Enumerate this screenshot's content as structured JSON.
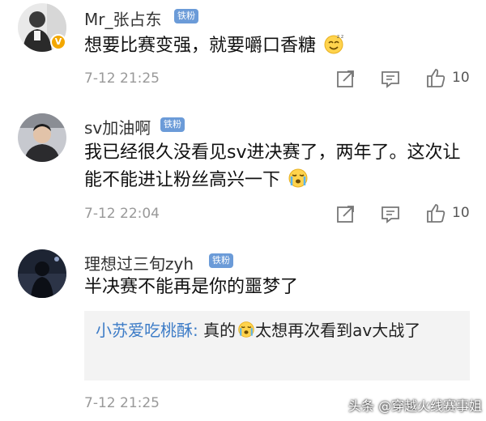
{
  "comments": [
    {
      "username": "Mr_张占东",
      "fan_badge": "铁粉",
      "text": "想要比赛变强，就要嚼口香糖",
      "emoji": "smile-emoji",
      "date": "7-12",
      "time": "21:25",
      "likes": "10",
      "verified": true
    },
    {
      "username": "sv加油啊",
      "fan_badge": "铁粉",
      "text": "我已经很久没看见sv进决赛了，两年了。这次让能不能进让粉丝高兴一下",
      "emoji": "crying-emoji",
      "date": "7-12",
      "time": "22:04",
      "likes": "10",
      "verified": false
    },
    {
      "username": "理想过三旬zyh",
      "fan_badge": "铁粉",
      "text": "半决赛不能再是你的噩梦了",
      "date": "7-12",
      "time": "21:25",
      "verified": false,
      "reply": {
        "user": "小苏爱吃桃酥:",
        "text_a": " 真的",
        "emoji": "crying-emoji",
        "text_b": "太想再次看到av大战了"
      }
    }
  ],
  "watermark": "头条 @穿越火线赛事姐",
  "colors": {
    "link_blue": "#3d7cc7",
    "badge_blue": "#6b9bd8",
    "vip_gold": "#f3a700",
    "meta_gray": "#999999"
  }
}
